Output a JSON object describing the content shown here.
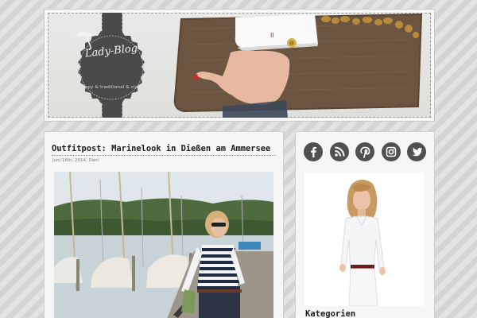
{
  "header": {
    "logo_title": "Lady-Blog",
    "logo_tagline": "preppy & traditional & classy"
  },
  "post": {
    "title": "Outfitpost: Marinelook in Dießen am Ammersee",
    "meta": "Juni 16th, 2014, Dani"
  },
  "sidebar": {
    "social": [
      {
        "name": "facebook-icon",
        "glyph": "f"
      },
      {
        "name": "rss-icon",
        "glyph": "rss"
      },
      {
        "name": "pinterest-icon",
        "glyph": "p"
      },
      {
        "name": "instagram-icon",
        "glyph": "cam"
      },
      {
        "name": "twitter-icon",
        "glyph": "bird"
      }
    ],
    "heading": "Kategorien"
  },
  "colors": {
    "icon_bg": "#505050",
    "ribbon": "#4a4a4a",
    "panel": "#f6f6f6"
  }
}
